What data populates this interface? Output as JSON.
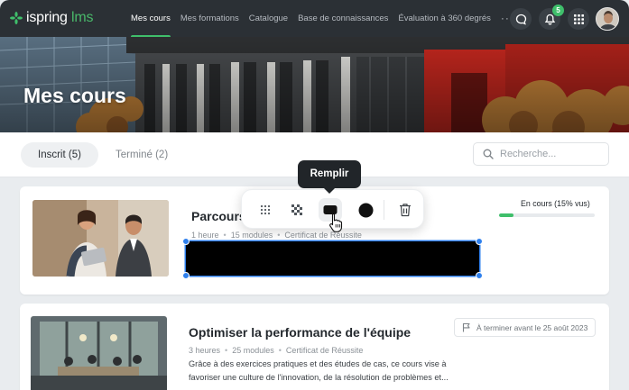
{
  "brand": {
    "name_main": "ispring",
    "name_accent": " lms"
  },
  "nav": {
    "items": [
      "Mes cours",
      "Mes formations",
      "Catalogue",
      "Base de connaissances",
      "Évaluation à 360 degrés"
    ],
    "more": "···"
  },
  "header": {
    "notifications_count": "5"
  },
  "hero": {
    "title": "Mes cours"
  },
  "tabs": [
    {
      "label": "Inscrit (5)"
    },
    {
      "label": "Terminé (2)"
    }
  ],
  "search": {
    "placeholder": "Recherche..."
  },
  "courses": [
    {
      "title": "Parcours",
      "meta": [
        "1 heure",
        "15 modules",
        "Certificat de Réussite"
      ],
      "status": "En cours (15% vus)",
      "progress_fraction": 0.15
    },
    {
      "title": "Optimiser la performance de l'équipe",
      "meta": [
        "3 heures",
        "25 modules",
        "Certificat de Réussite"
      ],
      "deadline": "À terminer avant le 25 août 2023",
      "description_line1": "Grâce à des exercices pratiques et des études de cas, ce cours vise à",
      "description_line2": "favoriser une culture de l'innovation, de la résolution de problèmes et..."
    }
  ],
  "toolbar": {
    "tooltip": "Remplir",
    "tools": [
      "blur-dots-icon",
      "pixelate-icon",
      "fill-rectangle-icon",
      "circle-icon",
      "trash-icon"
    ]
  },
  "colors": {
    "accent": "#3fbf6b",
    "topbar": "#2b3035",
    "selection": "#2f80ed"
  }
}
